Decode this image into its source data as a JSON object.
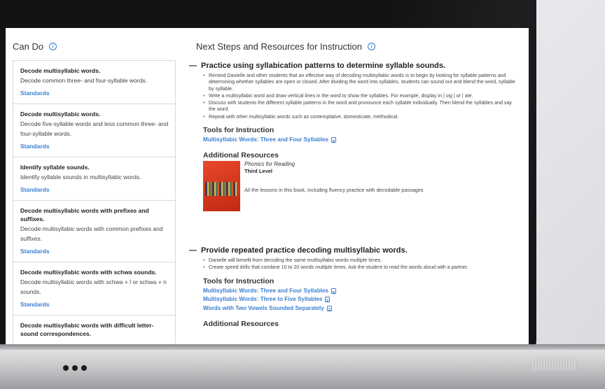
{
  "can_do": {
    "heading": "Can Do",
    "items": [
      {
        "title": "Decode multisyllabic words.",
        "desc": "Decode common three- and four-syllable words.",
        "link": "Standards"
      },
      {
        "title": "Decode multisyllabic words.",
        "desc": "Decode five-syllable words and less common three- and four-syllable words.",
        "link": "Standards"
      },
      {
        "title": "Identify syllable sounds.",
        "desc": "Identify syllable sounds in multisyllabic words.",
        "link": "Standards"
      },
      {
        "title": "Decode multisyllabic words with prefixes and suffixes.",
        "desc": "Decode multisyllabic words with common prefixes and suffixes.",
        "link": "Standards"
      },
      {
        "title": "Decode multisyllabic words with schwa sounds.",
        "desc": "Decode multisyllabic words with schwa + l or schwa + n sounds.",
        "link": "Standards"
      },
      {
        "title": "Decode multisyllabic words with difficult letter-sound correspondences.",
        "desc": "",
        "link": ""
      }
    ]
  },
  "next_steps": {
    "heading": "Next Steps and Resources for Instruction",
    "section1": {
      "toggle": "—",
      "title": "Practice using syllabication patterns to determine syllable sounds.",
      "bullets": [
        "Remind Danielle and other students that an effective way of decoding multisyllabic words is to begin by looking for syllable patterns and determining whether syllables are open or closed. After dividing the word into syllables, students can sound out and blend the word, syllable by syllable.",
        "Write a multisyllabic word and draw vertical lines in the word to show the syllables. For example, display in | vig | or | ate.",
        "Discuss with students the different syllable patterns in the word and pronounce each syllable individually. Then blend the syllables and say the word.",
        "Repeat with other multisyllabic words such as contemplative, domesticate, methodical."
      ],
      "tools_heading": "Tools for Instruction",
      "tools": [
        "Multisyllabic Words: Three and Four Syllables"
      ],
      "additional_heading": "Additional Resources",
      "book": {
        "title": "Phonics for Reading",
        "level": "Third Level",
        "desc": "All the lessons in this book, including fluency practice with decodable passages"
      }
    },
    "section2": {
      "toggle": "—",
      "title": "Provide repeated practice decoding multisyllabic words.",
      "bullets": [
        "Danielle will benefit from decoding the same multisyllabic words multiple times.",
        "Create speed drills that combine 10 to 20 words multiple times. Ask the student to read the words aloud with a partner."
      ],
      "tools_heading": "Tools for Instruction",
      "tools": [
        "Multisyllabic Words: Three and Four Syllables",
        "Multisyllabic Words: Three to Five Syllables",
        "Words with Two Vowels Sounded Separately"
      ],
      "additional_heading": "Additional Resources"
    }
  }
}
